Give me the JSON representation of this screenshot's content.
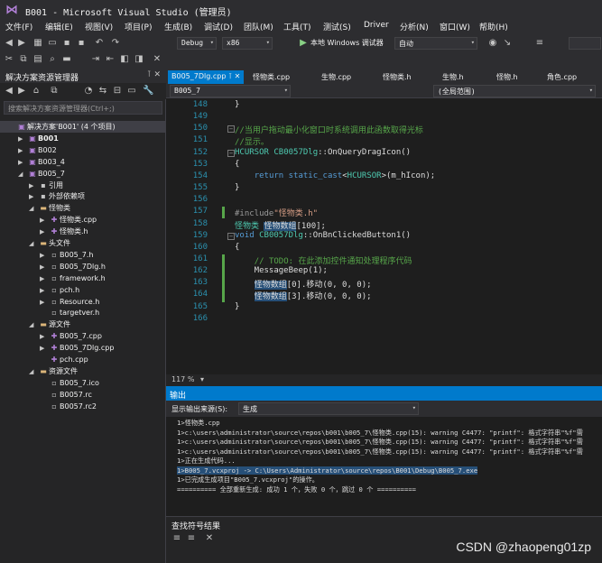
{
  "window": {
    "title": "B001 - Microsoft Visual Studio (管理员)",
    "logo": "visual-studio-logo"
  },
  "menu": [
    "文件(F)",
    "编辑(E)",
    "视图(V)",
    "项目(P)",
    "生成(B)",
    "调试(D)",
    "团队(M)",
    "工具(T)",
    "测试(S)",
    "Driver",
    "分析(N)",
    "窗口(W)",
    "帮助(H)"
  ],
  "toolbar": {
    "config": "Debug",
    "platform": "x86",
    "run_label": "本地 Windows 调试器",
    "auto": "自动"
  },
  "solution_explorer": {
    "title": "解决方案资源管理器",
    "search_placeholder": "搜索解决方案资源管理器(Ctrl+;)",
    "rows": [
      {
        "indent": 0,
        "toggle": "",
        "icon": "▣",
        "label": "解决方案'B001' (4 个项目)",
        "bold": false,
        "selected": true
      },
      {
        "indent": 1,
        "toggle": "▶",
        "icon": "▣",
        "label": "B001",
        "bold": true
      },
      {
        "indent": 1,
        "toggle": "▶",
        "icon": "▣",
        "label": "B002"
      },
      {
        "indent": 1,
        "toggle": "▶",
        "icon": "▣",
        "label": "B003_4"
      },
      {
        "indent": 1,
        "toggle": "◢",
        "icon": "▣",
        "label": "B005_7"
      },
      {
        "indent": 2,
        "toggle": "▶",
        "icon": "▪",
        "label": "引用"
      },
      {
        "indent": 2,
        "toggle": "▶",
        "icon": "▪",
        "label": "外部依赖项"
      },
      {
        "indent": 2,
        "toggle": "◢",
        "icon": "▬",
        "label": "怪物类"
      },
      {
        "indent": 3,
        "toggle": "▶",
        "icon": "✚",
        "label": "怪物类.cpp"
      },
      {
        "indent": 3,
        "toggle": "▶",
        "icon": "✚",
        "label": "怪物类.h"
      },
      {
        "indent": 2,
        "toggle": "◢",
        "icon": "▬",
        "label": "头文件"
      },
      {
        "indent": 3,
        "toggle": "▶",
        "icon": "▫",
        "label": "B005_7.h"
      },
      {
        "indent": 3,
        "toggle": "▶",
        "icon": "▫",
        "label": "B005_7Dlg.h"
      },
      {
        "indent": 3,
        "toggle": "▶",
        "icon": "▫",
        "label": "framework.h"
      },
      {
        "indent": 3,
        "toggle": "▶",
        "icon": "▫",
        "label": "pch.h"
      },
      {
        "indent": 3,
        "toggle": "▶",
        "icon": "▫",
        "label": "Resource.h"
      },
      {
        "indent": 3,
        "toggle": "",
        "icon": "▫",
        "label": "targetver.h"
      },
      {
        "indent": 2,
        "toggle": "◢",
        "icon": "▬",
        "label": "源文件"
      },
      {
        "indent": 3,
        "toggle": "▶",
        "icon": "✚",
        "label": "B005_7.cpp"
      },
      {
        "indent": 3,
        "toggle": "▶",
        "icon": "✚",
        "label": "B005_7Dlg.cpp"
      },
      {
        "indent": 3,
        "toggle": "",
        "icon": "✚",
        "label": "pch.cpp"
      },
      {
        "indent": 2,
        "toggle": "◢",
        "icon": "▬",
        "label": "资源文件"
      },
      {
        "indent": 3,
        "toggle": "",
        "icon": "▫",
        "label": "B005_7.ico"
      },
      {
        "indent": 3,
        "toggle": "",
        "icon": "▫",
        "label": "B0057.rc"
      },
      {
        "indent": 3,
        "toggle": "",
        "icon": "▫",
        "label": "B0057.rc2"
      }
    ]
  },
  "editor": {
    "tabs": [
      "B005_7Dlg.cpp",
      "怪物类.cpp",
      "生物.cpp",
      "怪物类.h",
      "生物.h",
      "怪物.h",
      "角色.cpp"
    ],
    "nav_project": "B005_7",
    "nav_scope": "(全局范围)",
    "zoom": "117 %",
    "lines": [
      {
        "n": "148",
        "html": "}"
      },
      {
        "n": "149",
        "html": ""
      },
      {
        "n": "150",
        "html": "<span class=\"cm\">//当用户拖动最小化窗口时系统调用此函数取得光标</span>"
      },
      {
        "n": "151",
        "html": "<span class=\"cm\">//显示。</span>"
      },
      {
        "n": "152",
        "html": "<span class=\"ty\">HCURSOR</span> <span class=\"ty\">CB0057Dlg</span>::OnQueryDragIcon()"
      },
      {
        "n": "153",
        "html": "{"
      },
      {
        "n": "154",
        "html": "    <span class=\"kw\">return</span> <span class=\"kw\">static_cast</span>&lt;<span class=\"ty\">HCURSOR</span>&gt;(m_hIcon);"
      },
      {
        "n": "155",
        "html": "}"
      },
      {
        "n": "156",
        "html": ""
      },
      {
        "n": "157",
        "html": "<span class=\"pp\">#include</span><span class=\"st\">\"怪物类.h\"</span>"
      },
      {
        "n": "158",
        "html": "<span class=\"ty\">怪物类</span> <span class=\"hl\">怪物数组</span>[100];"
      },
      {
        "n": "159",
        "html": "<span class=\"kw\">void</span> <span class=\"ty\">CB0057Dlg</span>::OnBnClickedButton1()"
      },
      {
        "n": "160",
        "html": "{"
      },
      {
        "n": "161",
        "html": "    <span class=\"cm\">// TODO: 在此添加控件通知处理程序代码</span>"
      },
      {
        "n": "162",
        "html": "    MessageBeep(1);"
      },
      {
        "n": "163",
        "html": "    <span class=\"hl\">怪物数组</span>[0].移动(0, 0, 0);"
      },
      {
        "n": "164",
        "html": "    <span class=\"hl\">怪物数组</span>[3].移动(0, 0, 0);"
      },
      {
        "n": "165",
        "html": "}"
      },
      {
        "n": "166",
        "html": ""
      }
    ]
  },
  "output": {
    "title": "输出",
    "source_label": "显示输出来源(S):",
    "source_value": "生成",
    "lines": [
      "1>怪物类.cpp",
      "1>c:\\users\\administrator\\source\\repos\\b001\\b005_7\\怪物类.cpp(15): warning C4477: \"printf\": 格式字符串\"%f\"需",
      "1>c:\\users\\administrator\\source\\repos\\b001\\b005_7\\怪物类.cpp(15): warning C4477: \"printf\": 格式字符串\"%f\"需",
      "1>c:\\users\\administrator\\source\\repos\\b001\\b005_7\\怪物类.cpp(15): warning C4477: \"printf\": 格式字符串\"%f\"需",
      "1>正在生成代码...",
      "1>B005_7.vcxproj -> C:\\Users\\Administrator\\source\\repos\\B001\\Debug\\B005_7.exe",
      "1>已完成生成项目\"B005_7.vcxproj\"的操作。",
      "========== 全部重新生成: 成功 1 个，失败 0 个，跳过 0 个 =========="
    ]
  },
  "find_symbols": {
    "title": "查找符号结果"
  },
  "watermark": "CSDN @zhaopeng01zp"
}
